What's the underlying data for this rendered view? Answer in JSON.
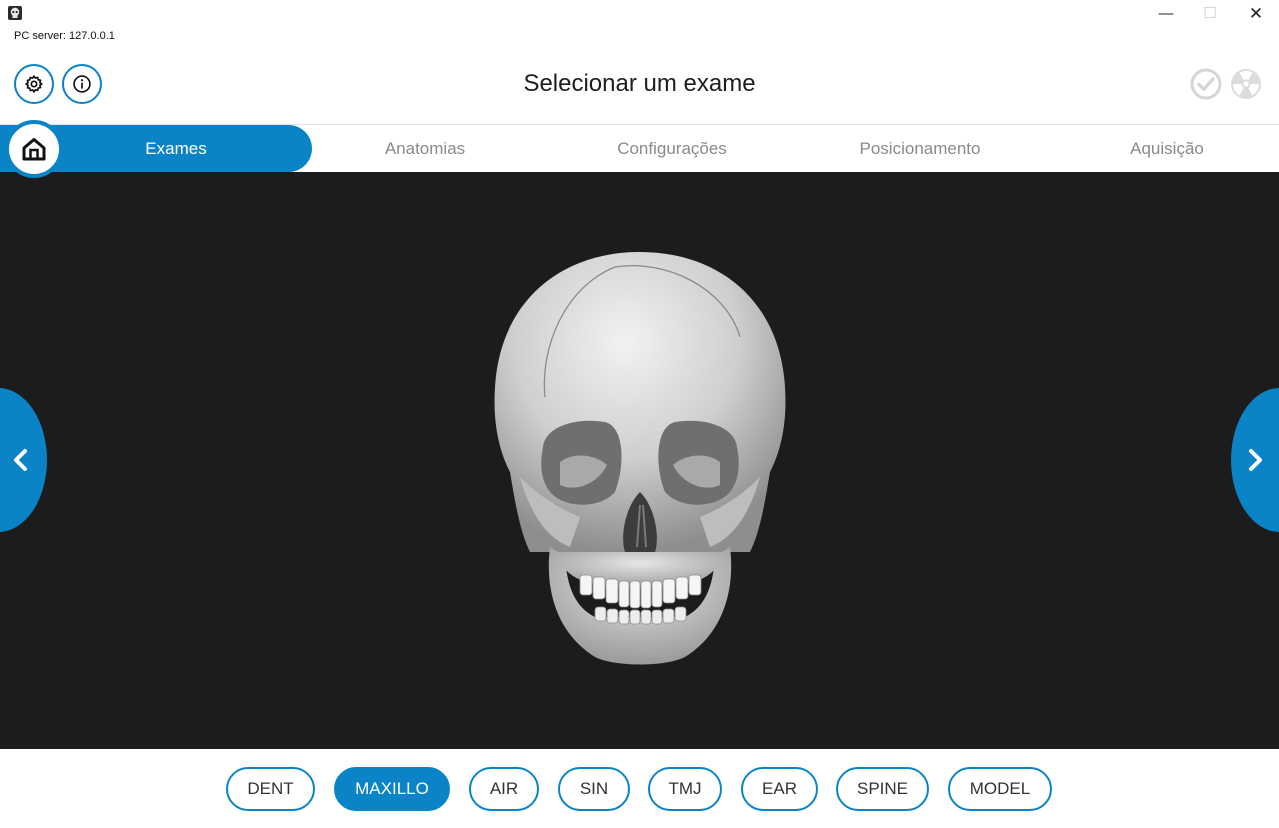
{
  "titlebar": {
    "server_label": "PC server: 127.0.0.1",
    "minimize": "—",
    "maximize": "☐",
    "close": "✕"
  },
  "header": {
    "title": "Selecionar um exame",
    "left_icons": [
      "gear-icon",
      "info-icon"
    ],
    "right_icons": [
      "check-circle-icon",
      "radiation-icon"
    ]
  },
  "tabs": [
    {
      "label": "Exames",
      "active": true
    },
    {
      "label": "Anatomias",
      "active": false
    },
    {
      "label": "Configurações",
      "active": false
    },
    {
      "label": "Posicionamento",
      "active": false
    },
    {
      "label": "Aquisição",
      "active": false
    }
  ],
  "viewer": {
    "image": "skull-3d-model",
    "prev_icon": "chevron-left-icon",
    "next_icon": "chevron-right-icon"
  },
  "exam_types": [
    {
      "label": "DENT",
      "active": false
    },
    {
      "label": "MAXILLO",
      "active": true
    },
    {
      "label": "AIR",
      "active": false
    },
    {
      "label": "SIN",
      "active": false
    },
    {
      "label": "TMJ",
      "active": false
    },
    {
      "label": "EAR",
      "active": false
    },
    {
      "label": "SPINE",
      "active": false
    },
    {
      "label": "MODEL",
      "active": false
    }
  ],
  "colors": {
    "accent": "#0a84c6",
    "viewport_bg": "#1c1c1c",
    "inactive_tab_text": "#8a8a8a"
  }
}
